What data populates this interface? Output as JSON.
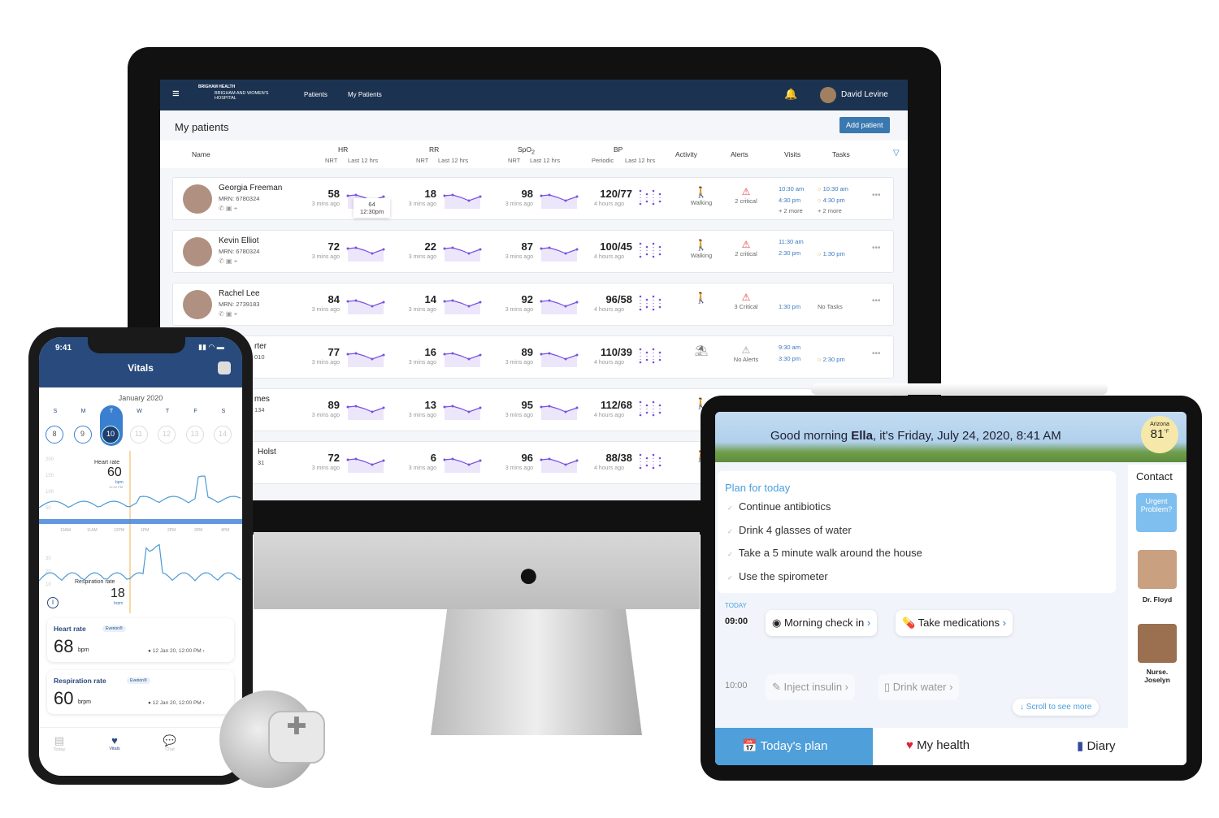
{
  "desktop": {
    "brand_top": "BRIGHAM HEALTH",
    "brand_name": "BRIGHAM AND WOMEN'S HOSPITAL",
    "breadcrumb": [
      "Patients",
      "My Patients"
    ],
    "user": "David Levine",
    "title": "My patients",
    "add_patient": "Add patient",
    "columns": {
      "name": "Name",
      "hr": "HR",
      "rr": "RR",
      "spo2": "SpO",
      "spo2_sub": "2",
      "bp": "BP",
      "nrt": "NRT",
      "last12": "Last 12 hrs",
      "periodic": "Periodic",
      "activity": "Activity",
      "alerts": "Alerts",
      "visits": "Visits",
      "tasks": "Tasks"
    },
    "tooltip": {
      "value": "64",
      "time": "12:30pm"
    },
    "rows": [
      {
        "name": "Georgia Freeman",
        "mrn": "MRN: 6780324",
        "hr": "58",
        "rr": "18",
        "spo2": "98",
        "bp": "120/77",
        "ago": "3 mins ago",
        "bp_ago": "4 hours ago",
        "activity": "Walking",
        "alerts": "2 critical",
        "visits": [
          "10:30 am",
          "4:30 pm",
          "+ 2 more"
        ],
        "tasks": [
          "10:30 am",
          "4:30 pm",
          "+ 2 more"
        ]
      },
      {
        "name": "Kevin Elliot",
        "mrn": "MRN: 6780324",
        "hr": "72",
        "rr": "22",
        "spo2": "87",
        "bp": "100/45",
        "ago": "3 mins ago",
        "bp_ago": "4 hours ago",
        "activity": "Walking",
        "alerts": "2 critical",
        "visits": [
          "11:30 am",
          "2:30 pm"
        ],
        "tasks": [
          "1:30 pm"
        ]
      },
      {
        "name": "Rachel Lee",
        "mrn": "MRN: 2739183",
        "hr": "84",
        "rr": "14",
        "spo2": "92",
        "bp": "96/58",
        "ago": "3 mins ago",
        "bp_ago": "4 hours ago",
        "activity": "",
        "alerts": "3 Critical",
        "visits": [
          "1:30 pm"
        ],
        "tasks": [
          "No Tasks"
        ]
      },
      {
        "name": "rter",
        "mrn": "010",
        "hr": "77",
        "rr": "16",
        "spo2": "89",
        "bp": "110/39",
        "ago": "3 mins ago",
        "bp_ago": "4 hours ago",
        "activity": "",
        "alerts": "No Alerts",
        "visits": [
          "9:30 am",
          "3:30 pm"
        ],
        "tasks": [
          "2:30 pm"
        ]
      },
      {
        "name": "mes",
        "mrn": "134",
        "hr": "89",
        "rr": "13",
        "spo2": "95",
        "bp": "112/68",
        "ago": "3 mins ago",
        "bp_ago": "4 hours ago",
        "activity": "",
        "alerts": "",
        "visits": [],
        "tasks": []
      },
      {
        "name": "Holst",
        "mrn": "31",
        "hr": "72",
        "rr": "6",
        "spo2": "96",
        "bp": "88/38",
        "ago": "3 mins ago",
        "bp_ago": "4 hours ago",
        "activity": "",
        "alerts": "",
        "visits": [],
        "tasks": []
      }
    ]
  },
  "phone": {
    "time": "9:41",
    "title": "Vitals",
    "month": "January 2020",
    "days": [
      "S",
      "M",
      "T",
      "W",
      "T",
      "F",
      "S"
    ],
    "dates": [
      "8",
      "9",
      "10",
      "11",
      "12",
      "13",
      "14"
    ],
    "hr_label": "Heart rate",
    "hr_value": "60",
    "hr_unit": "bpm",
    "hr_time": "12:20 PM",
    "y_ticks": [
      "200",
      "150",
      "100",
      "50"
    ],
    "times": [
      "10AM",
      "11AM",
      "12PM",
      "1PM",
      "2PM",
      "3PM",
      "4PM"
    ],
    "rr_ticks": [
      "30",
      "20",
      "10"
    ],
    "rr_label": "Respiration rate",
    "rr_value": "18",
    "rr_unit": "brpm",
    "cards": [
      {
        "label": "Heart rate",
        "badge": "Everion®",
        "value": "68",
        "unit": "bpm",
        "time": "12 Jan 20, 12:00 PM"
      },
      {
        "label": "Respiration rate",
        "badge": "Everion®",
        "value": "60",
        "unit": "brpm",
        "time": "12 Jan 20, 12:00 PM"
      }
    ],
    "nav": [
      "Today",
      "Vitals",
      "Chat",
      "Se"
    ]
  },
  "tablet": {
    "greeting_pre": "Good morning ",
    "greeting_name": "Ella",
    "greeting_post": ", it's Friday, July 24, 2020, 8:41 AM",
    "weather_place": "Arizona",
    "weather_temp": "81",
    "weather_unit": "°F",
    "plan_title": "Plan for today",
    "plan": [
      "Continue antibiotics",
      "Drink 4 glasses of water",
      "Take a 5 minute walk around the house",
      "Use the spirometer"
    ],
    "today": "TODAY",
    "t1": "09:00",
    "t2": "10:00",
    "tasks1": [
      "Morning check in",
      "Take medications"
    ],
    "tasks2": [
      "Inject insulin",
      "Drink water"
    ],
    "scroll": "↓ Scroll to see more",
    "contact_title": "Contact",
    "urgent": "Urgent Problem?",
    "contacts": [
      "Dr. Floyd",
      "Nurse. Joselyn"
    ],
    "nav": [
      "Today's plan",
      "My health",
      "Diary"
    ]
  },
  "colors": {
    "navy": "#1b3350",
    "accent": "#3a78c0",
    "spark": "#7b4fe0",
    "tablet_blue": "#4a9fdc"
  }
}
